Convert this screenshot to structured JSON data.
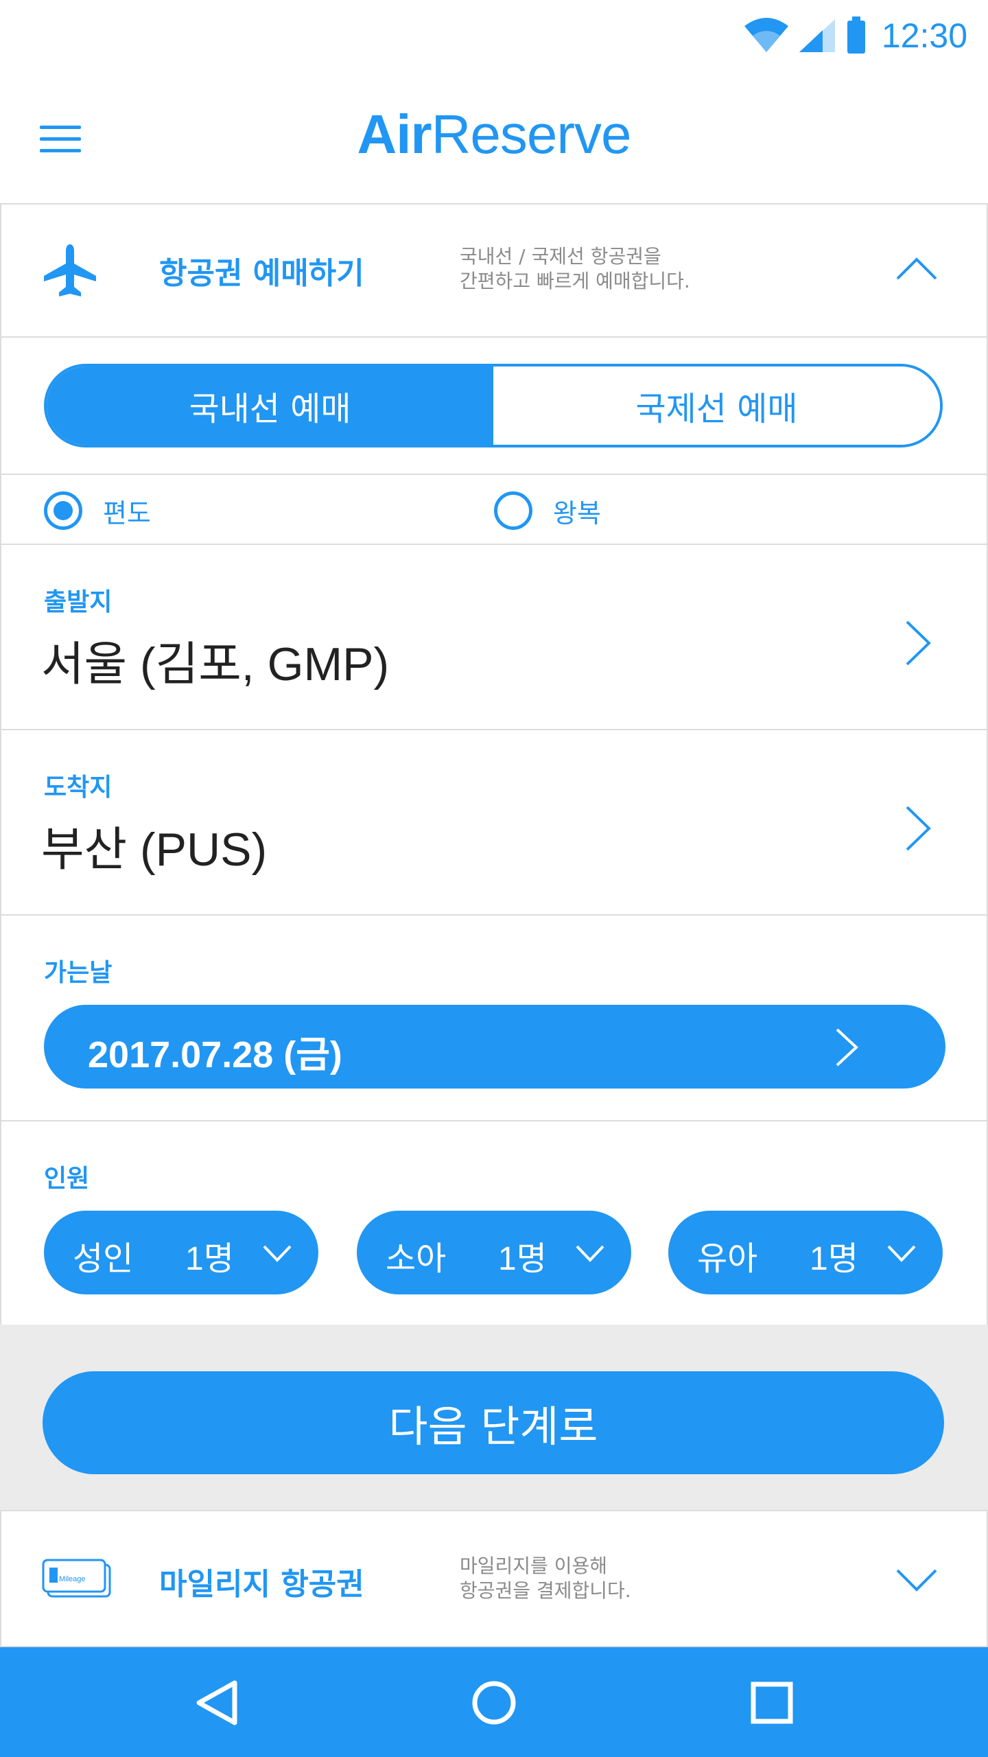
{
  "status_bar": {
    "time": "12:30"
  },
  "app_bar": {
    "title_bold": "Air",
    "title_regular": "Reserve"
  },
  "booking_section": {
    "title": "항공권 예매하기",
    "description_line1": "국내선 / 국제선 항공권을",
    "description_line2": "간편하고 빠르게 예매합니다."
  },
  "flight_type_tabs": [
    {
      "label": "국내선 예매",
      "active": true
    },
    {
      "label": "국제선 예매",
      "active": false
    }
  ],
  "trip_type": [
    {
      "label": "편도",
      "selected": true
    },
    {
      "label": "왕복",
      "selected": false
    }
  ],
  "departure": {
    "label": "출발지",
    "value": "서울 (김포, GMP)"
  },
  "arrival": {
    "label": "도착지",
    "value": "부산 (PUS)"
  },
  "departure_date": {
    "label": "가는날",
    "value": "2017.07.28 (금)"
  },
  "passengers": {
    "label": "인원",
    "items": [
      {
        "type": "성인",
        "count": "1명"
      },
      {
        "type": "소아",
        "count": "1명"
      },
      {
        "type": "유아",
        "count": "1명"
      }
    ]
  },
  "next_button": {
    "label": "다음 단계로"
  },
  "mileage_section": {
    "title": "마일리지 항공권",
    "description_line1": "마일리지를 이용해",
    "description_line2": "항공권을 결제합니다.",
    "card_icon_text": "Mileage"
  },
  "colors": {
    "accent": "#2196f3",
    "divider": "#dcdcdc",
    "band": "#ebebeb"
  }
}
